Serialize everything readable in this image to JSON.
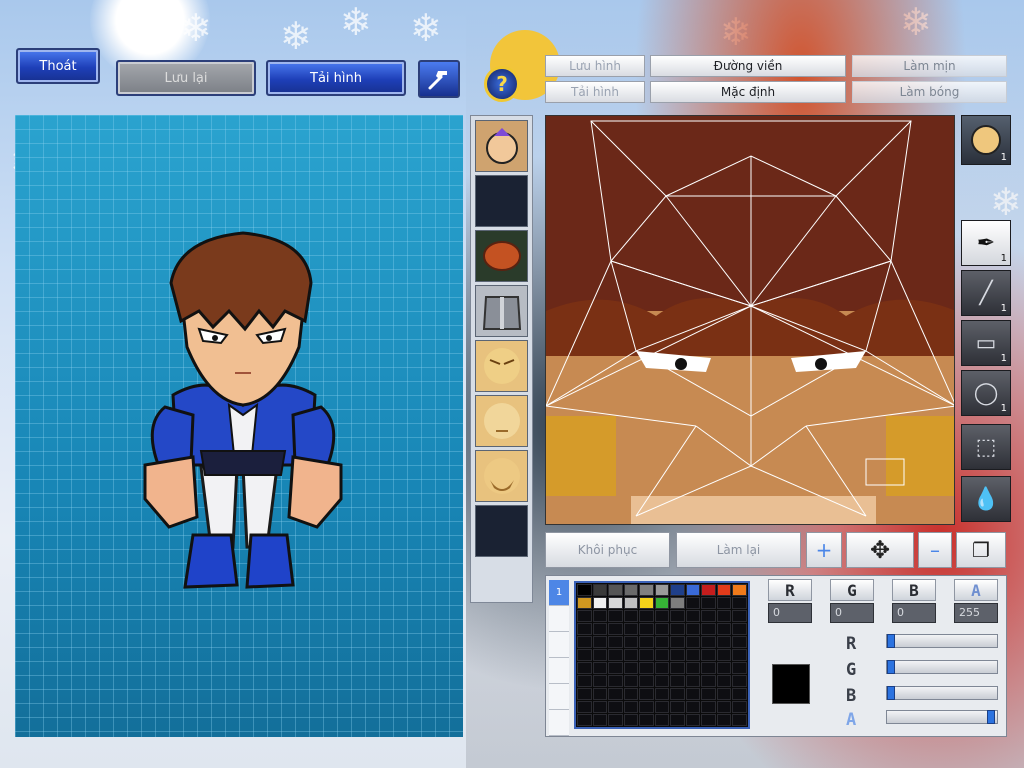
{
  "header": {
    "exit_label": "Thoát",
    "save_label": "Lưu lại",
    "reload_label": "Tải hình"
  },
  "segmented": {
    "save_image_label": "Lưu hình",
    "outline_label": "Đường viền",
    "smooth_label": "Làm mịn",
    "load_image_label": "Tải hình",
    "default_label": "Mặc định",
    "shade_label": "Làm bóng"
  },
  "tools": {
    "face_count": "1",
    "brush_count": "1",
    "line_count": "1",
    "rect_count": "1",
    "ellipse_count": "1"
  },
  "actions": {
    "restore_label": "Khôi phục",
    "redo_label": "Làm lại"
  },
  "color": {
    "r_label": "R",
    "g_label": "G",
    "b_label": "B",
    "a_label": "A",
    "r_value": "0",
    "g_value": "0",
    "b_value": "0",
    "a_value": "255",
    "selected": "#000000",
    "r_level": 0,
    "g_level": 0,
    "b_level": 0,
    "a_level": 1.0
  },
  "palette_tabs": [
    "1",
    "",
    "",
    "",
    "",
    ""
  ],
  "palette_colors": [
    "#000000",
    "#3a3a3a",
    "#555555",
    "#6a6a6a",
    "#808080",
    "#9a9a9a",
    "#1f3f8a",
    "#3a6ad8",
    "#c41d1d",
    "#e23b1a",
    "#f07a1a",
    "#d09820",
    "#f0f0f0",
    "#d8d8d8",
    "#c0c0c0",
    "#f4d21a",
    "#36b236",
    "#7d7d7d"
  ]
}
